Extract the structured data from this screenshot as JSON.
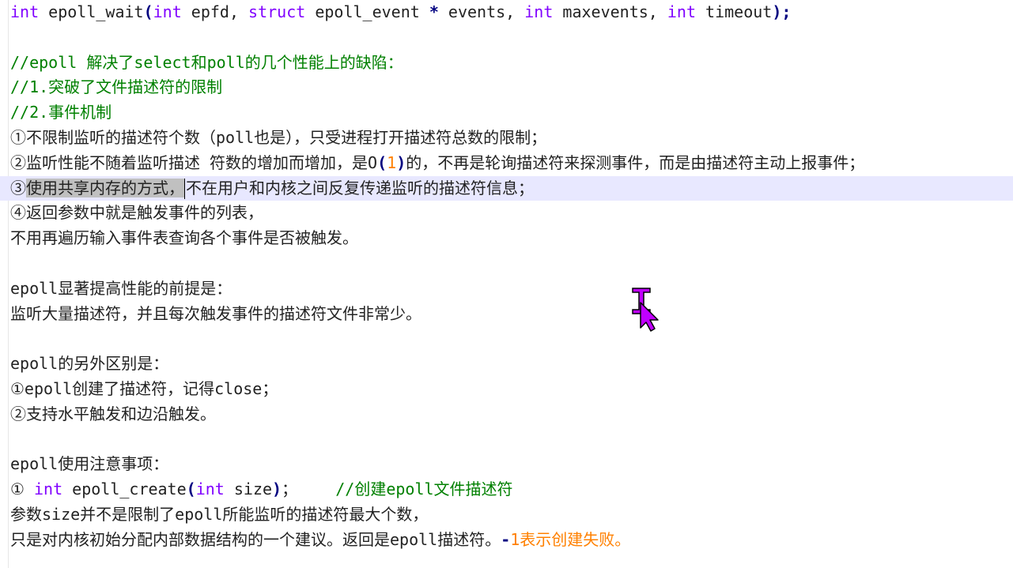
{
  "lines": [
    {
      "tokens": [
        [
          "kw",
          "int"
        ],
        [
          "t",
          " epoll_wait"
        ],
        [
          "op",
          "("
        ],
        [
          "kw",
          "int"
        ],
        [
          "t",
          " epfd, "
        ],
        [
          "kw",
          "struct"
        ],
        [
          "t",
          " epoll_event "
        ],
        [
          "op",
          "*"
        ],
        [
          "t",
          " events, "
        ],
        [
          "kw",
          "int"
        ],
        [
          "t",
          " maxevents, "
        ],
        [
          "kw",
          "int"
        ],
        [
          "t",
          " timeout"
        ],
        [
          "op",
          ");"
        ]
      ]
    },
    {
      "tokens": []
    },
    {
      "tokens": [
        [
          "cm",
          "//epoll 解决了select和poll的几个性能上的缺陷："
        ]
      ]
    },
    {
      "tokens": [
        [
          "cm",
          "//1.突破了文件描述符的限制"
        ]
      ]
    },
    {
      "tokens": [
        [
          "cm",
          "//2.事件机制"
        ]
      ]
    },
    {
      "tokens": [
        [
          "t",
          "①不限制监听的描述符个数（poll也是），只受进程打开描述符总数的限制；"
        ]
      ]
    },
    {
      "tokens": [
        [
          "t",
          "②监听性能不随着监听描述 符数的增加而增加，是O"
        ],
        [
          "op",
          "("
        ],
        [
          "num",
          "1"
        ],
        [
          "op",
          ")"
        ],
        [
          "t",
          "的，不再是轮询描述符来探测事件，而是由描述符主动上报事件；"
        ]
      ]
    },
    {
      "current": true,
      "tokens": [
        [
          "t",
          "③"
        ],
        [
          "sel",
          "使用共享内存的方式，"
        ],
        [
          "caret",
          ""
        ],
        [
          "t",
          "不在用户和内核之间反复传递监听的描述符信息；"
        ]
      ]
    },
    {
      "tokens": [
        [
          "t",
          "④返回参数中就是触发事件的列表，"
        ]
      ]
    },
    {
      "tokens": [
        [
          "t",
          "不用再遍历输入事件表查询各个事件是否被触发。"
        ]
      ]
    },
    {
      "tokens": []
    },
    {
      "tokens": [
        [
          "t",
          "epoll显著提高性能的前提是："
        ]
      ]
    },
    {
      "tokens": [
        [
          "t",
          "监听大量描述符，并且每次触发事件的描述符文件非常少。"
        ]
      ]
    },
    {
      "tokens": []
    },
    {
      "tokens": [
        [
          "t",
          "epoll的另外区别是："
        ]
      ]
    },
    {
      "tokens": [
        [
          "t",
          "①epoll创建了描述符，记得close；"
        ]
      ]
    },
    {
      "tokens": [
        [
          "t",
          "②支持水平触发和边沿触发。"
        ]
      ]
    },
    {
      "tokens": []
    },
    {
      "tokens": [
        [
          "t",
          "epoll使用注意事项："
        ]
      ]
    },
    {
      "tokens": [
        [
          "t",
          "① "
        ],
        [
          "kw",
          "int"
        ],
        [
          "t",
          " epoll_create"
        ],
        [
          "op",
          "("
        ],
        [
          "kw",
          "int"
        ],
        [
          "t",
          " size"
        ],
        [
          "op",
          ")"
        ],
        [
          "t",
          "；    "
        ],
        [
          "cm",
          "//创建epoll文件描述符"
        ]
      ]
    },
    {
      "tokens": [
        [
          "t",
          "参数size并不是限制了epoll所能监听的描述符最大个数，"
        ]
      ]
    },
    {
      "tokens": [
        [
          "t",
          "只是对内核初始分配内部数据结构的一个建议。返回是epoll描述符。"
        ],
        [
          "op",
          "-"
        ],
        [
          "num",
          "1表示创建失败。"
        ]
      ]
    }
  ],
  "colors": {
    "keyword": "#8000ff",
    "operator": "#000080",
    "comment": "#008000",
    "number": "#ff8000",
    "current_line": "#e8e8ff",
    "selection": "#c0c0c0",
    "cursor": "#c000ff"
  },
  "cursor_icon": "text-ibeam-and-arrow-cursor"
}
